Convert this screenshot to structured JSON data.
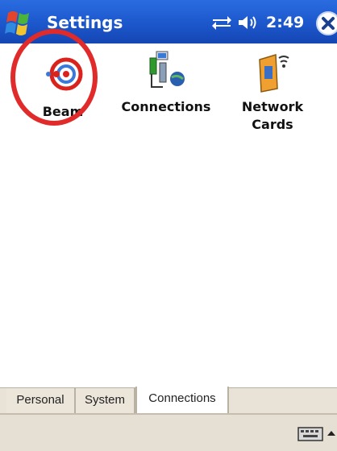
{
  "titlebar": {
    "title": "Settings",
    "time": "2:49",
    "icons": {
      "start": "windows-flag-icon",
      "connectivity": "connection-arrows-icon",
      "volume": "speaker-icon",
      "close": "close-icon"
    }
  },
  "items": [
    {
      "label": "Beam",
      "icon": "beam-icon",
      "highlighted": true
    },
    {
      "label": "Connections",
      "icon": "connections-icon"
    },
    {
      "label_line1": "Network",
      "label_line2": "Cards",
      "icon": "network-cards-icon"
    }
  ],
  "tabs": [
    {
      "label": "Personal",
      "active": false
    },
    {
      "label": "System",
      "active": false
    },
    {
      "label": "Connections",
      "active": true
    }
  ],
  "menubar": {
    "sip_icon": "keyboard-icon",
    "sip_arrow_icon": "up-arrow-icon"
  },
  "colors": {
    "titlebar_blue": "#1c57cc",
    "highlight_red": "#e12a2a",
    "tab_bg": "#e9e2d6"
  }
}
